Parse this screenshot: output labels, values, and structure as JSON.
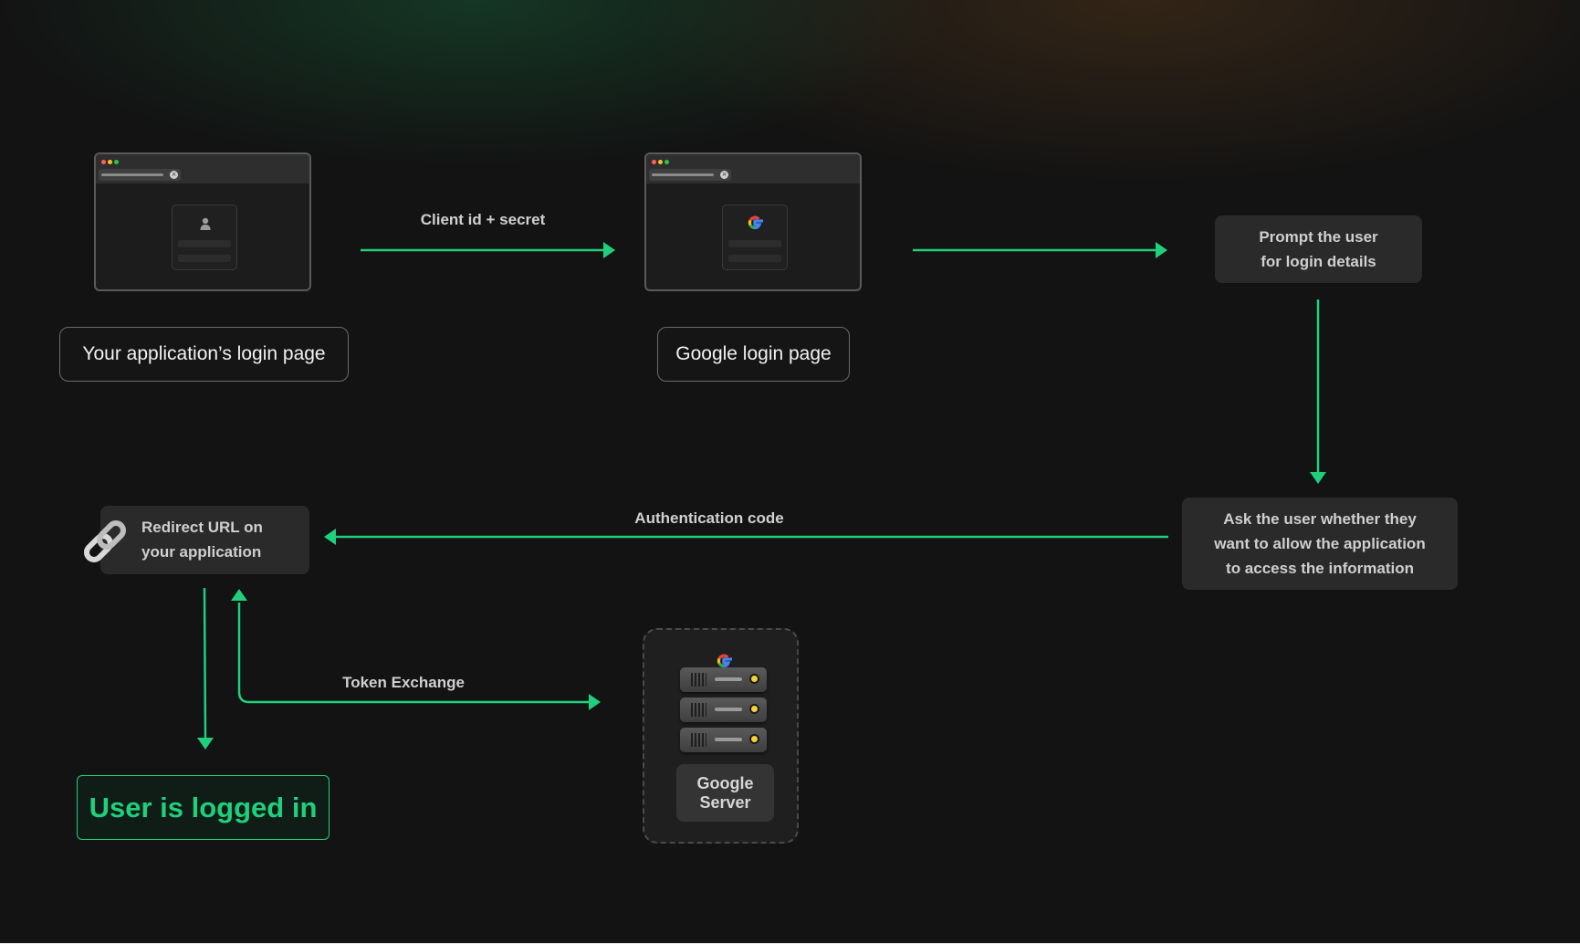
{
  "nodes": {
    "app_login_page": {
      "label": "Your application’s login page"
    },
    "google_login_page": {
      "label": "Google login page"
    },
    "prompt_user": {
      "label": "Prompt the user\nfor login details"
    },
    "ask_user": {
      "label": "Ask the user whether they\nwant to allow the application\nto access the information"
    },
    "redirect_url": {
      "label": "Redirect URL on\nyour application"
    },
    "user_logged_in": {
      "label": "User is logged in"
    },
    "google_server": {
      "label": "Google\nServer"
    }
  },
  "edges": {
    "client_id_secret": {
      "label": "Client id + secret"
    },
    "authentication_code": {
      "label": "Authentication code"
    },
    "token_exchange": {
      "label": "Token Exchange"
    }
  },
  "icons": {
    "app_page_card": "user-icon",
    "google_page_card": "google-logo-icon",
    "redirect": "link-icon",
    "server": "server-rack-icon"
  },
  "colors": {
    "accent": "#1fcf7c",
    "background": "#131313",
    "box": "#2a2a2a"
  }
}
